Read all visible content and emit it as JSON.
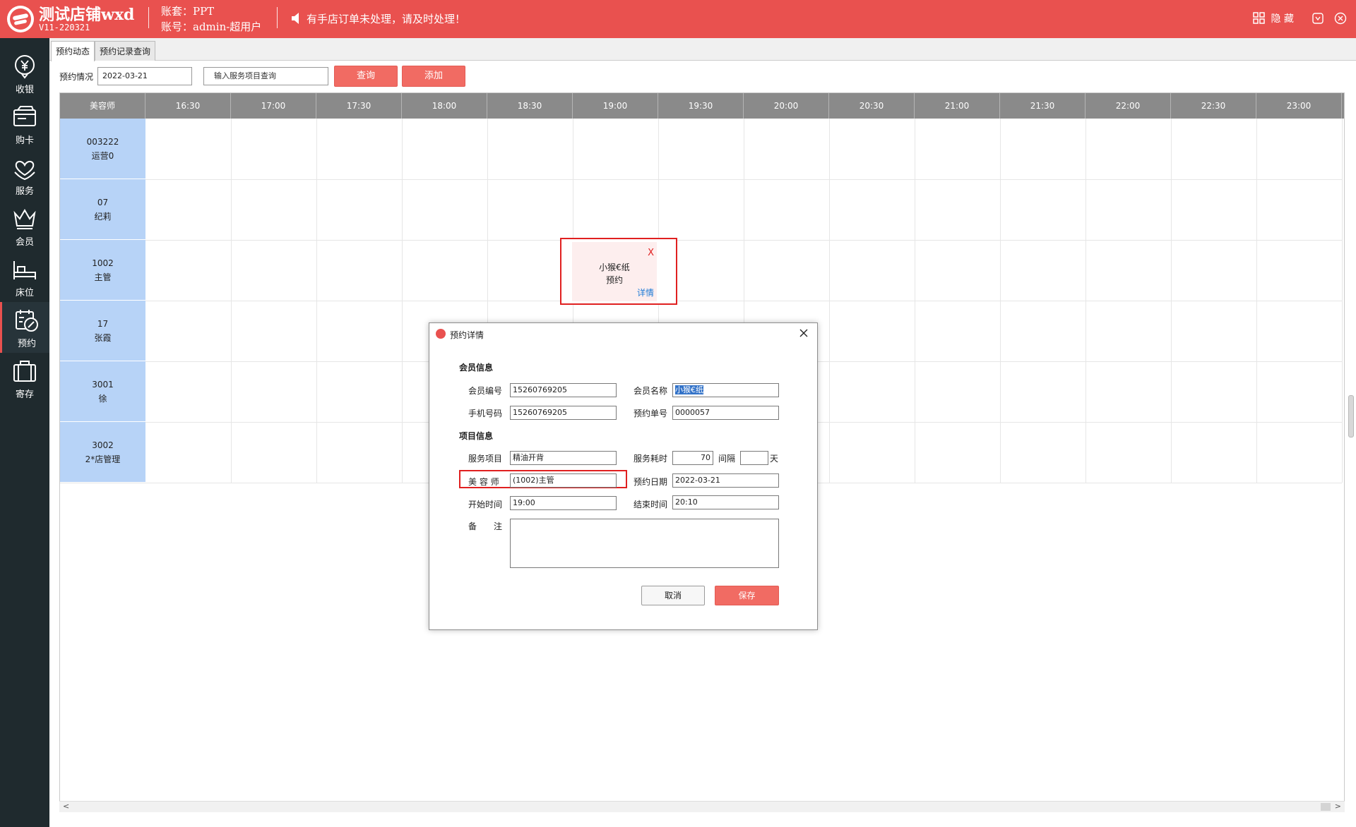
{
  "header": {
    "shop_name": "测试店铺wxd",
    "version": "V11-220321",
    "account_set": "账套：PPT",
    "account": "账号：admin-超用户",
    "notice": "有手店订单未处理，请及时处理！",
    "hide_label": "隐 藏",
    "brand_color": "#e9514f"
  },
  "sidebar": {
    "items": [
      {
        "label": "收银",
        "icon": "cashier-icon"
      },
      {
        "label": "购卡",
        "icon": "card-icon"
      },
      {
        "label": "服务",
        "icon": "service-icon"
      },
      {
        "label": "会员",
        "icon": "member-icon"
      },
      {
        "label": "床位",
        "icon": "bed-icon"
      },
      {
        "label": "预约",
        "icon": "appointment-icon",
        "active": true
      },
      {
        "label": "寄存",
        "icon": "storage-icon"
      }
    ]
  },
  "tabs": [
    "预约动态",
    "预约记录查询"
  ],
  "toolbar": {
    "label": "预约情况",
    "date": "2022-03-21",
    "search_placeholder": "输入服务项目查询",
    "query_label": "查询",
    "add_label": "添加"
  },
  "grid": {
    "corner": "美容师",
    "times": [
      "16:30",
      "17:00",
      "17:30",
      "18:00",
      "18:30",
      "19:00",
      "19:30",
      "20:00",
      "20:30",
      "21:00",
      "21:30",
      "22:00",
      "22:30",
      "23:00"
    ],
    "staff": [
      {
        "code": "003222",
        "name": "运营0"
      },
      {
        "code": "07",
        "name": "纪莉"
      },
      {
        "code": "1002",
        "name": "主管"
      },
      {
        "code": "17",
        "name": "张霞"
      },
      {
        "code": "3001",
        "name": "徐"
      },
      {
        "code": "3002",
        "name": "2*店管理"
      }
    ]
  },
  "appointment": {
    "close": "X",
    "name": "小猴€纸",
    "type": "预约",
    "detail": "详情"
  },
  "dialog": {
    "title": "预约详情",
    "member_section": "会员信息",
    "project_section": "项目信息",
    "member_no_label": "会员编号",
    "member_no": "15260769205",
    "member_name_label": "会员名称",
    "member_name": "小猴€纸",
    "phone_label": "手机号码",
    "phone": "15260769205",
    "order_no_label": "预约单号",
    "order_no": "0000057",
    "service_label": "服务项目",
    "service": "精油开背",
    "duration_label": "服务耗时",
    "duration": "70",
    "interval_label": "间隔",
    "interval": "",
    "day_label": "天",
    "beautician_label": "美 容 师",
    "beautician": "(1002)主管",
    "date_label": "预约日期",
    "date": "2022-03-21",
    "start_label": "开始时间",
    "start": "19:00",
    "end_label": "结束时间",
    "end": "20:10",
    "remark_label": "备　　注",
    "remark": "",
    "cancel_label": "取消",
    "save_label": "保存"
  }
}
